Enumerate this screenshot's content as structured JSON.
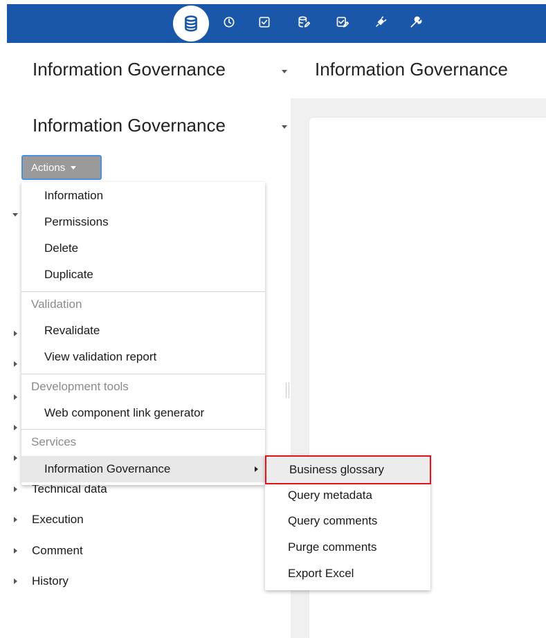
{
  "toolbar": {
    "icons": [
      "database-icon",
      "clock-icon",
      "checklist-icon",
      "database-edit-icon",
      "check-edit-icon",
      "plug-icon",
      "wrench-icon"
    ],
    "accent": "#1a57a8"
  },
  "header": {
    "left_title": "Information Governance",
    "right_title": "Information Governance"
  },
  "panel": {
    "title": "Information Governance",
    "actions_label": "Actions"
  },
  "tree": [
    {
      "label": "Technical data"
    },
    {
      "label": "Execution"
    },
    {
      "label": "Comment"
    },
    {
      "label": "History"
    }
  ],
  "menu": {
    "items": [
      "Information",
      "Permissions",
      "Delete",
      "Duplicate"
    ],
    "validation_header": "Validation",
    "validation_items": [
      "Revalidate",
      "View validation report"
    ],
    "dev_header": "Development tools",
    "dev_items": [
      "Web component link generator"
    ],
    "services_header": "Services",
    "services_items": [
      "Information Governance"
    ]
  },
  "submenu": {
    "items": [
      "Business glossary",
      "Query metadata",
      "Query comments",
      "Purge comments",
      "Export Excel"
    ],
    "highlight_color": "#e0141b"
  }
}
